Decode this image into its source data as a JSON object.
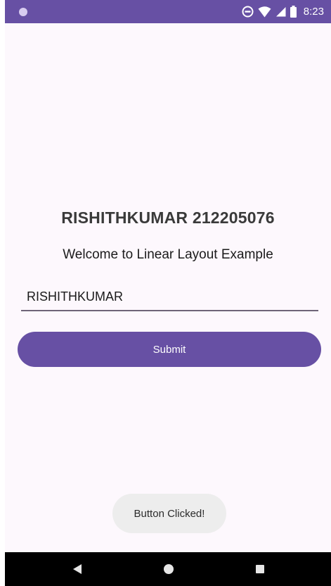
{
  "status_bar": {
    "time": "8:23",
    "icons": [
      "notification-dot-icon",
      "do-not-disturb-icon",
      "wifi-icon",
      "signal-icon",
      "battery-icon"
    ]
  },
  "main": {
    "title": "RISHITHKUMAR 212205076",
    "subtitle": "Welcome to Linear Layout Example",
    "input_value": "RISHITHKUMAR",
    "submit_label": "Submit"
  },
  "toast": {
    "message": "Button Clicked!"
  },
  "nav_bar": {
    "icons": [
      "back-icon",
      "home-icon",
      "recents-icon"
    ]
  },
  "colors": {
    "primary": "#6750a4",
    "background": "#fdf8fd",
    "toast_bg": "#ededed"
  }
}
